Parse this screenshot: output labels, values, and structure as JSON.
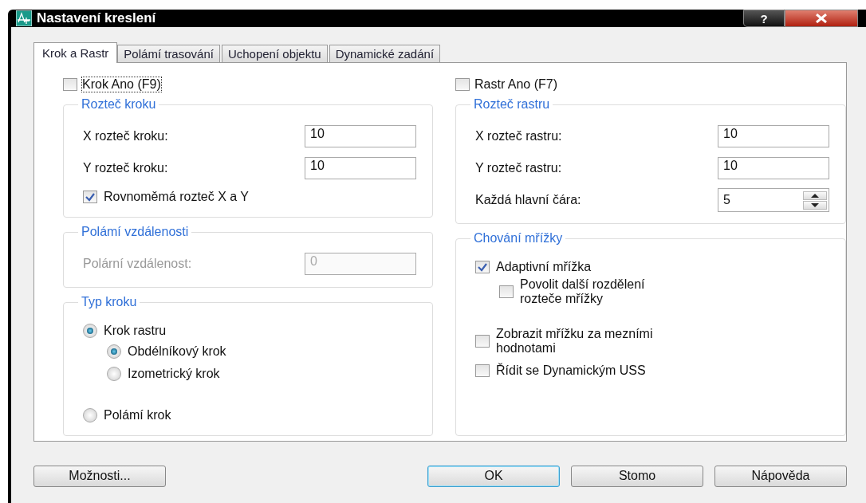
{
  "window": {
    "title": "Nastavení kreslení",
    "help_button": "?"
  },
  "tabs": [
    {
      "label": "Krok a Rastr",
      "selected": true
    },
    {
      "label": "Polámí trasování",
      "selected": false
    },
    {
      "label": "Uchopení objektu",
      "selected": false
    },
    {
      "label": "Dynamické zadání",
      "selected": false
    }
  ],
  "columns": [
    {
      "top_checkbox": {
        "label": "Krok Ano (F9)",
        "checked": false,
        "focused": true
      },
      "groups": [
        {
          "title": "Rozteč kroku",
          "rows": [
            {
              "kind": "field",
              "label": "X rozteč kroku:",
              "value": "10",
              "disabled": false
            },
            {
              "kind": "field",
              "label": "Y rozteč kroku:",
              "value": "10",
              "disabled": false
            },
            {
              "kind": "checkbox",
              "label": "Rovnoměmá rozteč X a Y",
              "checked": true
            }
          ]
        },
        {
          "title": "Polámí vzdálenosti",
          "rows": [
            {
              "kind": "field",
              "label": "Polární vzdálenost:",
              "value": "0",
              "disabled": true
            }
          ]
        },
        {
          "title": "Typ  kroku",
          "rows": [
            {
              "kind": "radio",
              "label": "Krok rastru",
              "selected": true,
              "children": [
                {
                  "kind": "radio",
                  "label": "Obdélníkový krok",
                  "selected": true
                },
                {
                  "kind": "radio",
                  "label": "Izometrický krok",
                  "selected": false
                }
              ]
            },
            {
              "kind": "radio",
              "label": "Polámí krok",
              "selected": false
            }
          ]
        }
      ]
    },
    {
      "top_checkbox": {
        "label": "Rastr Ano (F7)",
        "checked": false,
        "focused": false
      },
      "groups": [
        {
          "title": "Rozteč rastru",
          "rows": [
            {
              "kind": "field",
              "label": "X rozteč rastru:",
              "value": "10",
              "disabled": false
            },
            {
              "kind": "field",
              "label": "Y rozteč rastru:",
              "value": "10",
              "disabled": false
            },
            {
              "kind": "spinner",
              "label": "Každá hlavní čára:",
              "value": "5"
            }
          ]
        },
        {
          "title": "Chování mřížky",
          "rows": [
            {
              "kind": "checkbox",
              "label": "Adaptivní mřížka",
              "checked": true,
              "children": [
                {
                  "kind": "checkbox",
                  "label": "Povolit další rozdělení\nrozteče mřížky",
                  "checked": false
                }
              ]
            },
            {
              "kind": "checkbox",
              "label": "Zobrazit mřížku za mezními\nhodnotami",
              "checked": false
            },
            {
              "kind": "checkbox",
              "label": "Řídit se Dynamickým USS",
              "checked": false
            }
          ]
        }
      ]
    }
  ],
  "buttons": [
    {
      "label": "Možnosti...",
      "default": false
    },
    {
      "label": "OK",
      "default": true
    },
    {
      "label": "Stomo",
      "default": false
    },
    {
      "label": "Nápověda",
      "default": false
    }
  ]
}
